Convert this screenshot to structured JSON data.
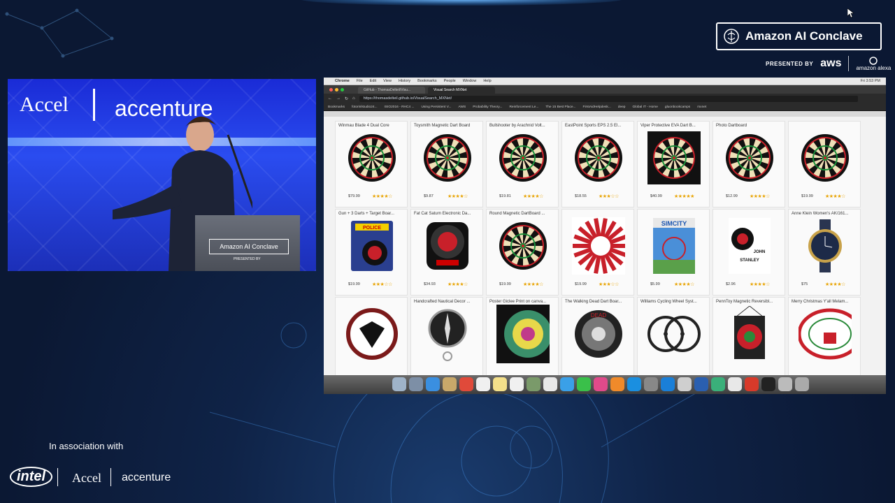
{
  "event": {
    "brand_name": "Amazon AI Conclave",
    "presented_by": "PRESENTED BY",
    "aws": "aws",
    "alexa": "amazon alexa",
    "association": "In association with",
    "intel": "intel",
    "accel": "Accel",
    "accenture": "accenture"
  },
  "video": {
    "accel": "Accel",
    "accenture": "accenture",
    "podium_badge": "Amazon AI Conclave",
    "podium_presented": "PRESENTED BY"
  },
  "browser": {
    "menubar": {
      "app": "Chrome",
      "items": [
        "File",
        "Edit",
        "View",
        "History",
        "Bookmarks",
        "People",
        "Window",
        "Help"
      ],
      "clock": "Fri 3:53 PM"
    },
    "tabs": [
      {
        "label": "GitHub - ThomasDelteil/Visu..."
      },
      {
        "label": "Visual Search MXNet"
      }
    ],
    "url": "https://thomasdelteil.github.io/VisualSearch_MXNet/",
    "bookmarks": [
      "Bookmarks",
      "fotorinlstudio24...",
      "ISIO2016 - RHC4 ...",
      "Using Persistent V...",
      "AWS",
      "Probability Theory...",
      "Reinforcement Le...",
      "The 15 Best Place...",
      "FirstAidHelpdesk...",
      "deep",
      "Global IT - Home",
      "gluonbookcamps",
      "mxnet"
    ]
  },
  "products": [
    {
      "title": "Winmau Blade 4 Dual Core",
      "price": "$79.99",
      "stars": "★★★★☆",
      "kind": "board"
    },
    {
      "title": "Toysmith Magnetic Dart Board",
      "price": "$9.87",
      "stars": "★★★★☆",
      "kind": "board"
    },
    {
      "title": "Bullshooter by Arachnid Volt...",
      "price": "$19.81",
      "stars": "★★★★☆",
      "kind": "board"
    },
    {
      "title": "EastPoint Sports EPS 2.5 El...",
      "price": "$18.55",
      "stars": "★★★☆☆",
      "kind": "board"
    },
    {
      "title": "Viper Protective EVA Dart B...",
      "price": "$40.99",
      "stars": "★★★★★",
      "kind": "boarddark"
    },
    {
      "title": "Photo Dartboard",
      "price": "$12.99",
      "stars": "★★★★☆",
      "kind": "board"
    },
    {
      "title": "",
      "price": "$19.99",
      "stars": "★★★★☆",
      "kind": "board"
    },
    {
      "title": "Gun + 3 Darts + Target Boar...",
      "price": "$19.99",
      "stars": "★★★☆☆",
      "kind": "pack"
    },
    {
      "title": "Fat Cat Saturn Electronic Da...",
      "price": "$34.93",
      "stars": "★★★★☆",
      "kind": "electronic"
    },
    {
      "title": "Round Magnetic DartBoard ...",
      "price": "$19.99",
      "stars": "★★★★☆",
      "kind": "board"
    },
    {
      "title": "",
      "price": "$19.99",
      "stars": "★★★☆☆",
      "kind": "target"
    },
    {
      "title": "",
      "price": "$5.99",
      "stars": "★★★★☆",
      "kind": "game"
    },
    {
      "title": "",
      "price": "$2.96",
      "stars": "★★★★☆",
      "kind": "book"
    },
    {
      "title": "Anne Klein Women's AK/161...",
      "price": "$75",
      "stars": "★★★★☆",
      "kind": "watch"
    },
    {
      "title": "",
      "price": "",
      "stars": "",
      "kind": "shield"
    },
    {
      "title": "Handcrafted Nautical Decor ...",
      "price": "",
      "stars": "",
      "kind": "compass"
    },
    {
      "title": "Poster Giclee Print on canva...",
      "price": "",
      "stars": "",
      "kind": "art"
    },
    {
      "title": "The Walking Dead Dart Boar...",
      "price": "",
      "stars": "",
      "kind": "boarddark2"
    },
    {
      "title": "Williams Cycling Wheel Syst...",
      "price": "",
      "stars": "",
      "kind": "wheels"
    },
    {
      "title": "PennToy Magnetic Reversibl...",
      "price": "",
      "stars": "",
      "kind": "hanging"
    },
    {
      "title": "Merry Christmas Y'all Melam...",
      "price": "",
      "stars": "",
      "kind": "plate"
    }
  ],
  "colors": {
    "accent": "#2a4cf0",
    "star": "#e8a300"
  }
}
